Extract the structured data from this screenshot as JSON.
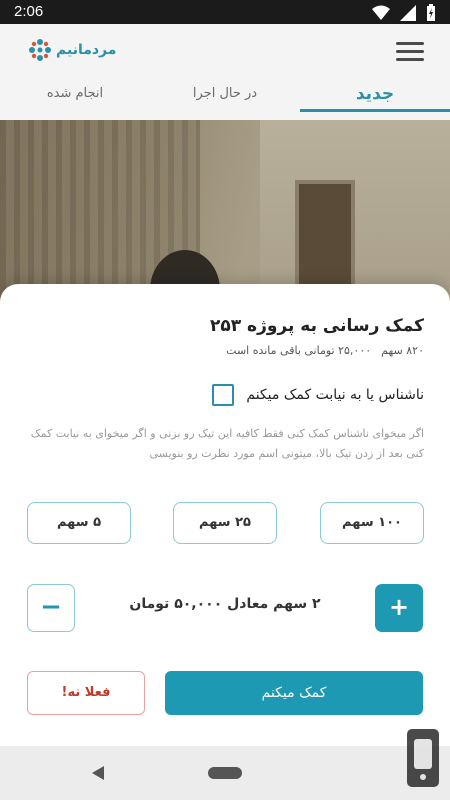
{
  "status_bar": {
    "time": "2:06",
    "icons": [
      "wifi-icon",
      "signal-icon",
      "battery-charging-icon"
    ]
  },
  "header": {
    "logo_text": "مردمانیم",
    "menu_icon": "hamburger-menu-icon"
  },
  "tabs": [
    {
      "label": "جدید",
      "active": true
    },
    {
      "label": "در حال اجرا",
      "active": false
    },
    {
      "label": "انجام شده",
      "active": false
    }
  ],
  "sheet": {
    "title": "کمک رسانی به پروژه ۲۵۳",
    "shares_remaining": "۸۲۰ سهم",
    "amount_remaining": "۲۵,۰۰۰ تومانی باقی مانده است",
    "anonymous_label": "ناشناس یا به نیابت کمک میکنم",
    "hint": "اگر میخوای ناشناس کمک کنی فقط کافیه این تیک رو بزنی و اگر میخوای به نیابت کمک کنی بعد از زدن تیک بالا، میتونی اسم مورد نظرت رو بنویسی",
    "share_options": [
      "۱۰۰ سهم",
      "۲۵ سهم",
      "۵ سهم"
    ],
    "quantity_text": "۲ سهم معادل ۵۰,۰۰۰ تومان",
    "plus_label": "+",
    "minus_label": "−",
    "help_button": "کمک میکنم",
    "later_button": "فعلا نه!"
  },
  "colors": {
    "accent": "#1d99b3",
    "danger": "#c0392b",
    "tab_accent": "#2a8fa8"
  }
}
